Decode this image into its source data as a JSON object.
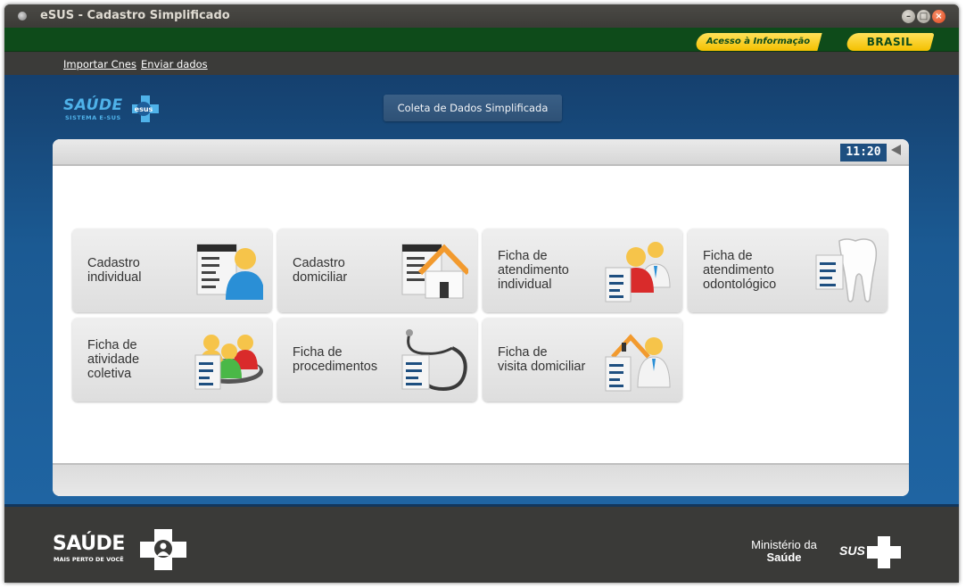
{
  "window": {
    "title": "eSUS - Cadastro Simplificado"
  },
  "govbar": {
    "acesso_label": "Acesso à Informação",
    "brasil_label": "BRASIL"
  },
  "links": {
    "importar": "Importar Cnes",
    "enviar": "Enviar dados"
  },
  "header": {
    "logo_word": "SAÚDE",
    "logo_sub": "SISTEMA E-SUS",
    "logo_badge": "esus",
    "coleta_label": "Coleta de Dados Simplificada"
  },
  "panel": {
    "clock": "11:20"
  },
  "tiles": [
    {
      "label": "Cadastro\nindividual",
      "icon": "person-form-icon"
    },
    {
      "label": "Cadastro\ndomiciliar",
      "icon": "house-form-icon"
    },
    {
      "label": "Ficha de\natendimento\nindividual",
      "icon": "patient-doctor-form-icon"
    },
    {
      "label": "Ficha de\natendimento\nodontológico",
      "icon": "tooth-form-icon"
    },
    {
      "label": "Ficha de\natividade\ncoletiva",
      "icon": "group-form-icon"
    },
    {
      "label": "Ficha de\nprocedimentos",
      "icon": "stethoscope-form-icon"
    },
    {
      "label": "Ficha de\nvisita domiciliar",
      "icon": "home-visit-form-icon"
    }
  ],
  "footer": {
    "saude_word": "SAÚDE",
    "saude_sub": "MAIS PERTO DE VOCÊ",
    "ministerio_line1": "Ministério da",
    "ministerio_line2": "Saúde",
    "sus_word": "SUS"
  },
  "colors": {
    "brand_blue": "#1b5a93",
    "gov_green": "#0e4b1a",
    "gov_yellow": "#f4c000",
    "clock_bg": "#1e4f80"
  }
}
